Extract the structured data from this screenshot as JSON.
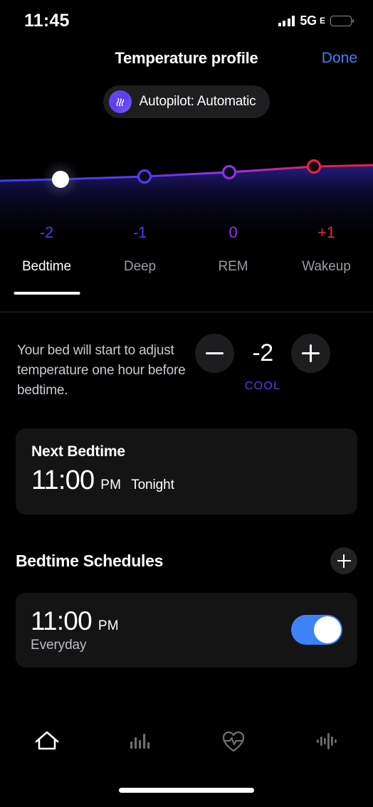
{
  "status_bar": {
    "time": "11:45",
    "network": "5G",
    "network_sub": "E",
    "battery_color": "#f3d31c",
    "signal_icon": "cellular-signal-icon",
    "battery_icon": "battery-icon"
  },
  "header": {
    "title": "Temperature profile",
    "done_label": "Done",
    "done_color": "#3d83f5"
  },
  "autopilot": {
    "label": "Autopilot: Automatic",
    "icon": "heat-waves-icon",
    "icon_color": "#5b3df0"
  },
  "chart_data": {
    "type": "line",
    "title": "Temperature profile",
    "categories": [
      "Bedtime",
      "Deep",
      "REM",
      "Wakeup"
    ],
    "values": [
      -2,
      -1,
      0,
      1
    ],
    "value_labels": [
      "-2",
      "-1",
      "0",
      "+1"
    ],
    "point_colors": [
      "#4b3df0",
      "#5b3df0",
      "#8b3ae0",
      "#e0244a"
    ],
    "value_label_colors": [
      "#4b3df0",
      "#4b3df0",
      "#9b30e8",
      "#e0244a"
    ],
    "active_index": 0,
    "active_point_color": "#ffffff",
    "line_gradient": [
      "#3a3df5",
      "#5b3df0",
      "#9b30e8",
      "#e0244a"
    ],
    "xlabel": "",
    "ylabel": "",
    "grid": false,
    "legend": false
  },
  "tabs": {
    "items": [
      {
        "label": "Bedtime",
        "active": true
      },
      {
        "label": "Deep",
        "active": false
      },
      {
        "label": "REM",
        "active": false
      },
      {
        "label": "Wakeup",
        "active": false
      }
    ]
  },
  "stepper": {
    "description": "Your bed will start to adjust temperature one hour before bedtime.",
    "minus_label": "minus",
    "plus_label": "plus",
    "value": "-2",
    "caption": "COOL",
    "caption_color": "#5b3df0"
  },
  "next_bedtime": {
    "title": "Next Bedtime",
    "time": "11:00",
    "meridiem": "PM",
    "when": "Tonight"
  },
  "schedules": {
    "title": "Bedtime Schedules",
    "add_icon": "plus-icon",
    "items": [
      {
        "time": "11:00",
        "meridiem": "PM",
        "repeat": "Everyday",
        "enabled": true,
        "toggle_color": "#3d83f5"
      }
    ]
  },
  "tabbar": {
    "items": [
      {
        "icon": "home-icon",
        "active": true
      },
      {
        "icon": "bar-chart-icon",
        "active": false
      },
      {
        "icon": "heart-pulse-icon",
        "active": false
      },
      {
        "icon": "waveform-icon",
        "active": false
      }
    ]
  }
}
